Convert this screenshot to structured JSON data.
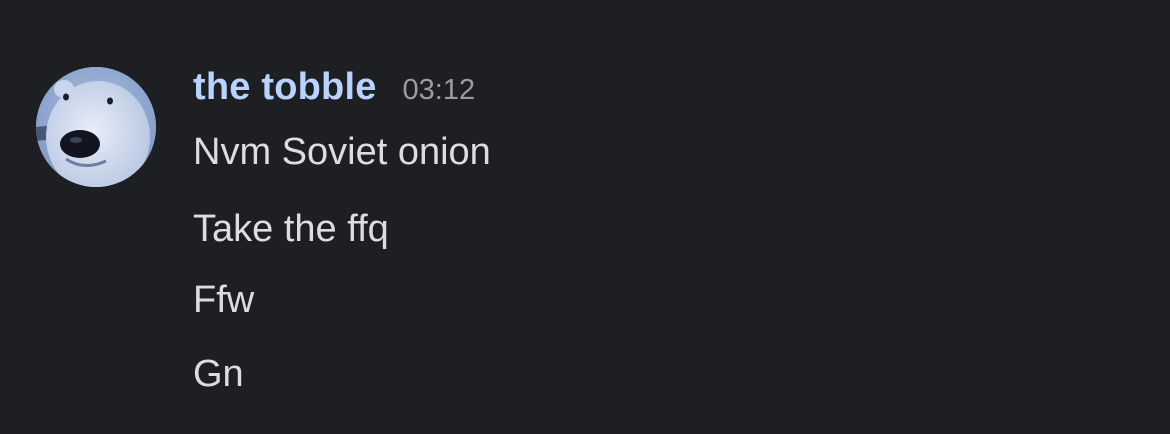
{
  "message": {
    "author": "the tobble",
    "timestamp": "03:12",
    "avatar_icon": "polar-bear-avatar",
    "author_color": "#b8d3ff",
    "lines": [
      "Nvm Soviet onion",
      "Take the ffq",
      "Ffw",
      "Gn"
    ]
  }
}
